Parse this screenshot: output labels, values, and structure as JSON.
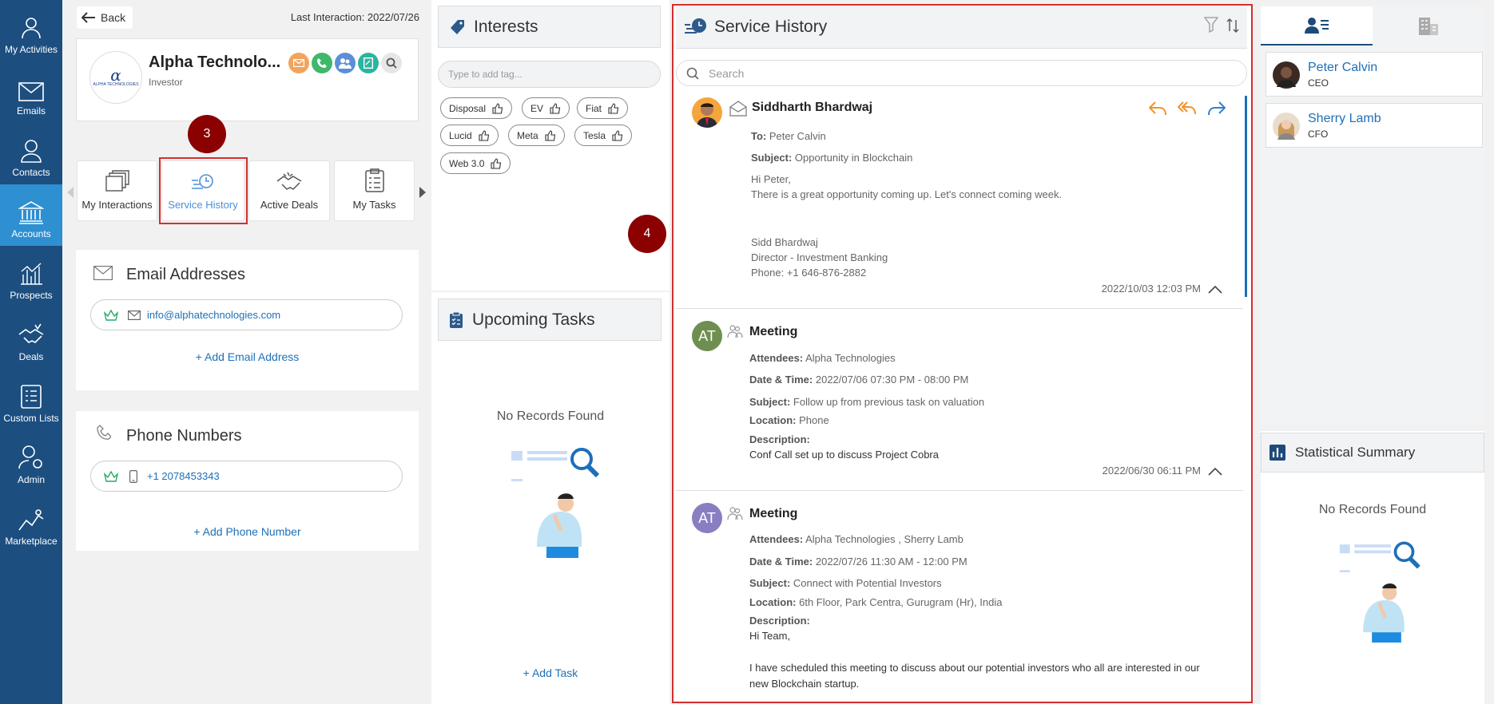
{
  "sidebar": {
    "items": [
      {
        "label": "My Activities",
        "icon": "person-icon"
      },
      {
        "label": "Emails",
        "icon": "envelope-icon"
      },
      {
        "label": "Contacts",
        "icon": "contact-icon"
      },
      {
        "label": "Accounts",
        "icon": "bank-icon"
      },
      {
        "label": "Prospects",
        "icon": "chart-icon"
      },
      {
        "label": "Deals",
        "icon": "handshake-icon"
      },
      {
        "label": "Custom Lists",
        "icon": "list-icon"
      },
      {
        "label": "Admin",
        "icon": "admin-icon"
      },
      {
        "label": "Marketplace",
        "icon": "marketplace-icon"
      }
    ]
  },
  "header": {
    "back_label": "Back",
    "last_interaction": "Last Interaction: 2022/07/26"
  },
  "account": {
    "name": "Alpha Technolo...",
    "type": "Investor",
    "logo_text": "ALPHA TECHNOLOGIES"
  },
  "tabs": [
    {
      "label": "My Interactions"
    },
    {
      "label": "Service History"
    },
    {
      "label": "Active Deals"
    },
    {
      "label": "My Tasks"
    }
  ],
  "annotations": {
    "badge3": "3",
    "badge4": "4"
  },
  "email_section": {
    "title": "Email Addresses",
    "email": "info@alphatechnologies.com",
    "add_label": "+ Add Email Address"
  },
  "phone_section": {
    "title": "Phone Numbers",
    "phone": "+1 2078453343",
    "add_label": "+ Add Phone Number"
  },
  "interests": {
    "title": "Interests",
    "placeholder": "Type to add tag...",
    "tags": [
      "Disposal",
      "EV",
      "Fiat",
      "Lucid",
      "Meta",
      "Tesla",
      "Web 3.0"
    ]
  },
  "tasks": {
    "title": "Upcoming Tasks",
    "empty": "No Records Found",
    "add_label": "+ Add Task"
  },
  "service_history": {
    "title": "Service History",
    "search_placeholder": "Search",
    "email": {
      "sender": "Siddharth Bhardwaj",
      "to_label": "To:",
      "to": "Peter Calvin",
      "subject_label": "Subject:",
      "subject": "Opportunity in Blockchain",
      "body1": "Hi Peter,",
      "body2": "There is a great opportunity coming up. Let's connect coming week.",
      "sig1": "Sidd Bhardwaj",
      "sig2": "Director - Investment Banking",
      "sig3": "Phone: +1 646-876-2882",
      "timestamp": "2022/10/03 12:03 PM"
    },
    "meeting1": {
      "initials": "AT",
      "title": "Meeting",
      "attendees_label": "Attendees:",
      "attendees": "Alpha Technologies",
      "datetime_label": "Date & Time:",
      "datetime": "2022/07/06 07:30 PM - 08:00 PM",
      "subject_label": "Subject:",
      "subject": "Follow up from previous task on valuation",
      "location_label": "Location:",
      "location": "Phone",
      "description_label": "Description:",
      "description": "Conf Call set up to discuss Project Cobra",
      "timestamp": "2022/06/30 06:11 PM"
    },
    "meeting2": {
      "initials": "AT",
      "title": "Meeting",
      "attendees_label": "Attendees:",
      "attendees": "Alpha Technologies , Sherry Lamb",
      "datetime_label": "Date & Time:",
      "datetime": "2022/07/26 11:30 AM - 12:00 PM",
      "subject_label": "Subject:",
      "subject": "Connect with Potential Investors",
      "location_label": "Location:",
      "location": "6th Floor, Park Centra, Gurugram (Hr), India",
      "description_label": "Description:",
      "desc1": "Hi Team,",
      "desc2": "I have scheduled this meeting to discuss about our potential investors who all are interested in our",
      "desc3": "new Blockchain startup."
    }
  },
  "contacts": [
    {
      "name": "Peter Calvin",
      "role": "CEO"
    },
    {
      "name": "Sherry Lamb",
      "role": "CFO"
    }
  ],
  "stats": {
    "title": "Statistical Summary",
    "empty": "No Records Found"
  },
  "colors": {
    "sidebar": "#1c4e80",
    "accent": "#2e8fd1",
    "highlight": "#d32f2f",
    "badge": "#8b0000"
  }
}
